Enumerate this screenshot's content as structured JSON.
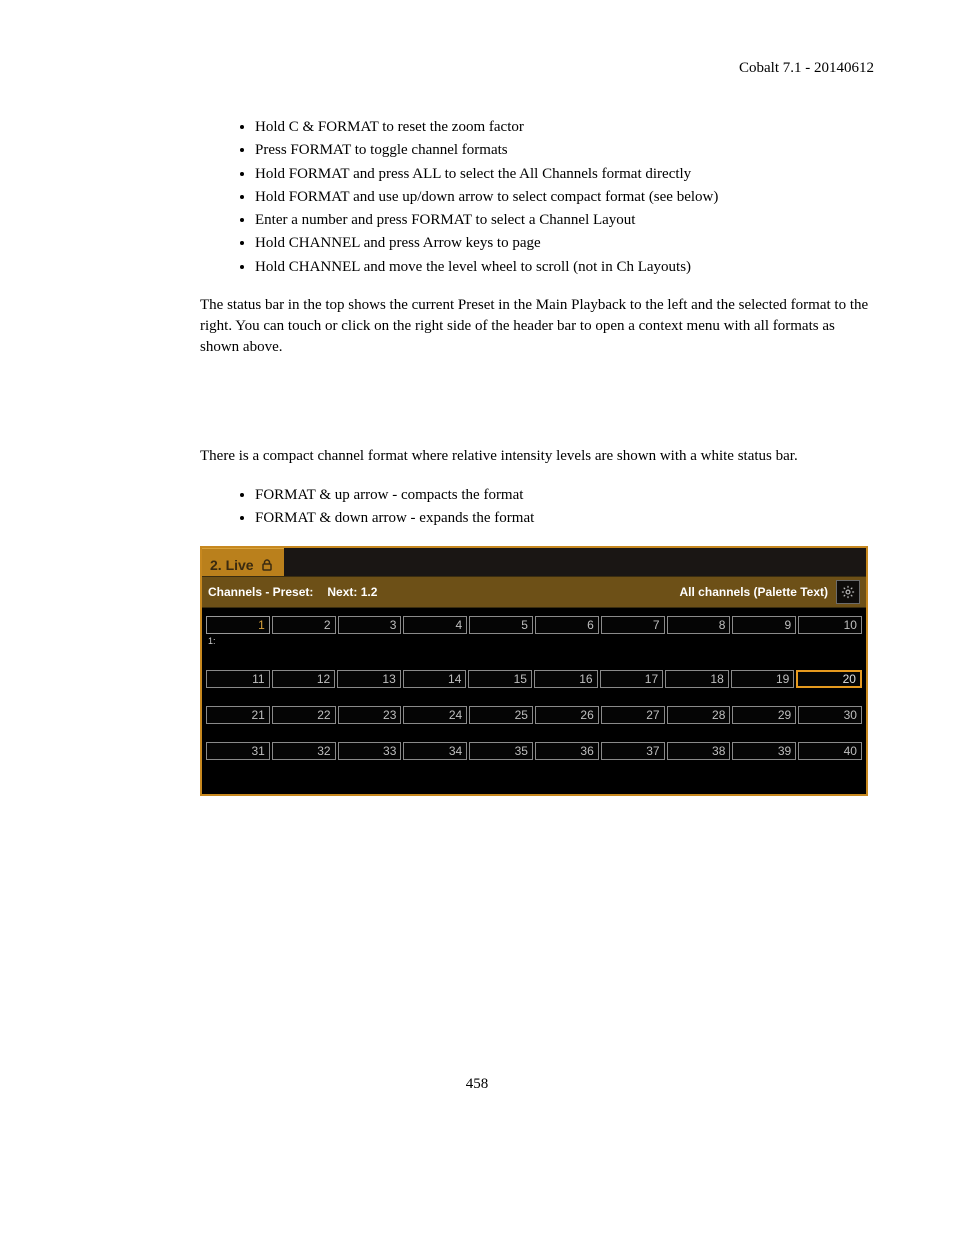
{
  "header": {
    "product": "Cobalt 7.1 - 20140612"
  },
  "list1": {
    "items": [
      "Hold C & FORMAT to reset the zoom factor",
      "Press FORMAT to toggle channel formats",
      "Hold FORMAT and press ALL to select the All Channels format directly",
      "Hold FORMAT and use up/down arrow to select compact format (see below)",
      "Enter a number and press FORMAT to select a Channel Layout",
      "Hold CHANNEL and press Arrow keys to page",
      "Hold CHANNEL and move the level wheel to scroll (not in Ch Layouts)"
    ]
  },
  "para1": "The status bar in the top shows the current Preset in the Main Playback to the left and the selected format to the right. You can touch or click on the right side of the header bar to open a context menu with all formats as shown above.",
  "para2": "There is a compact channel format where relative intensity levels are shown with a white status bar.",
  "list2": {
    "items": [
      "FORMAT & up arrow - compacts the format",
      "FORMAT & down arrow - expands the format"
    ]
  },
  "screenshot": {
    "tab": "2. Live",
    "status_left": "Channels - Preset:",
    "status_mid": "Next: 1.2",
    "status_right": "All channels (Palette Text)",
    "sublabel": "1:",
    "rows": [
      [
        "1",
        "2",
        "3",
        "4",
        "5",
        "6",
        "7",
        "8",
        "9",
        "10"
      ],
      [
        "11",
        "12",
        "13",
        "14",
        "15",
        "16",
        "17",
        "18",
        "19",
        "20"
      ],
      [
        "21",
        "22",
        "23",
        "24",
        "25",
        "26",
        "27",
        "28",
        "29",
        "30"
      ],
      [
        "31",
        "32",
        "33",
        "34",
        "35",
        "36",
        "37",
        "38",
        "39",
        "40"
      ]
    ],
    "selected_index": 0,
    "highlight_index": 19
  },
  "page_number": "458"
}
